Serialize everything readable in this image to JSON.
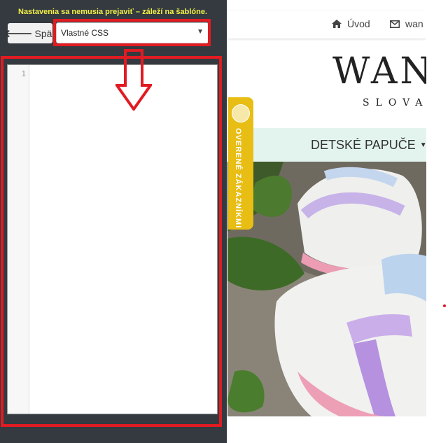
{
  "left_panel": {
    "notice": "Nastavenia sa nemusia prejaviť – záleží na šablóne.",
    "back_button": "Späť",
    "back_icon": "arrow-left-icon",
    "select": {
      "value": "Vlastné CSS"
    },
    "editor": {
      "line_numbers": [
        "1"
      ],
      "content": ""
    },
    "highlight_color": "#e11b22"
  },
  "preview": {
    "nav": [
      {
        "icon": "home-icon",
        "label": "Úvod"
      },
      {
        "icon": "envelope-icon",
        "label": "wan"
      }
    ],
    "logo": "WAN",
    "logo_sub": "SLOVA",
    "menu": {
      "label": "DETSKÉ PAPUČE"
    },
    "badge_text": "OVERENÉ ZÁKAZNÍKMI",
    "colors": {
      "menu_bg": "#e3f4ee",
      "badge": "#e8bd14"
    }
  }
}
